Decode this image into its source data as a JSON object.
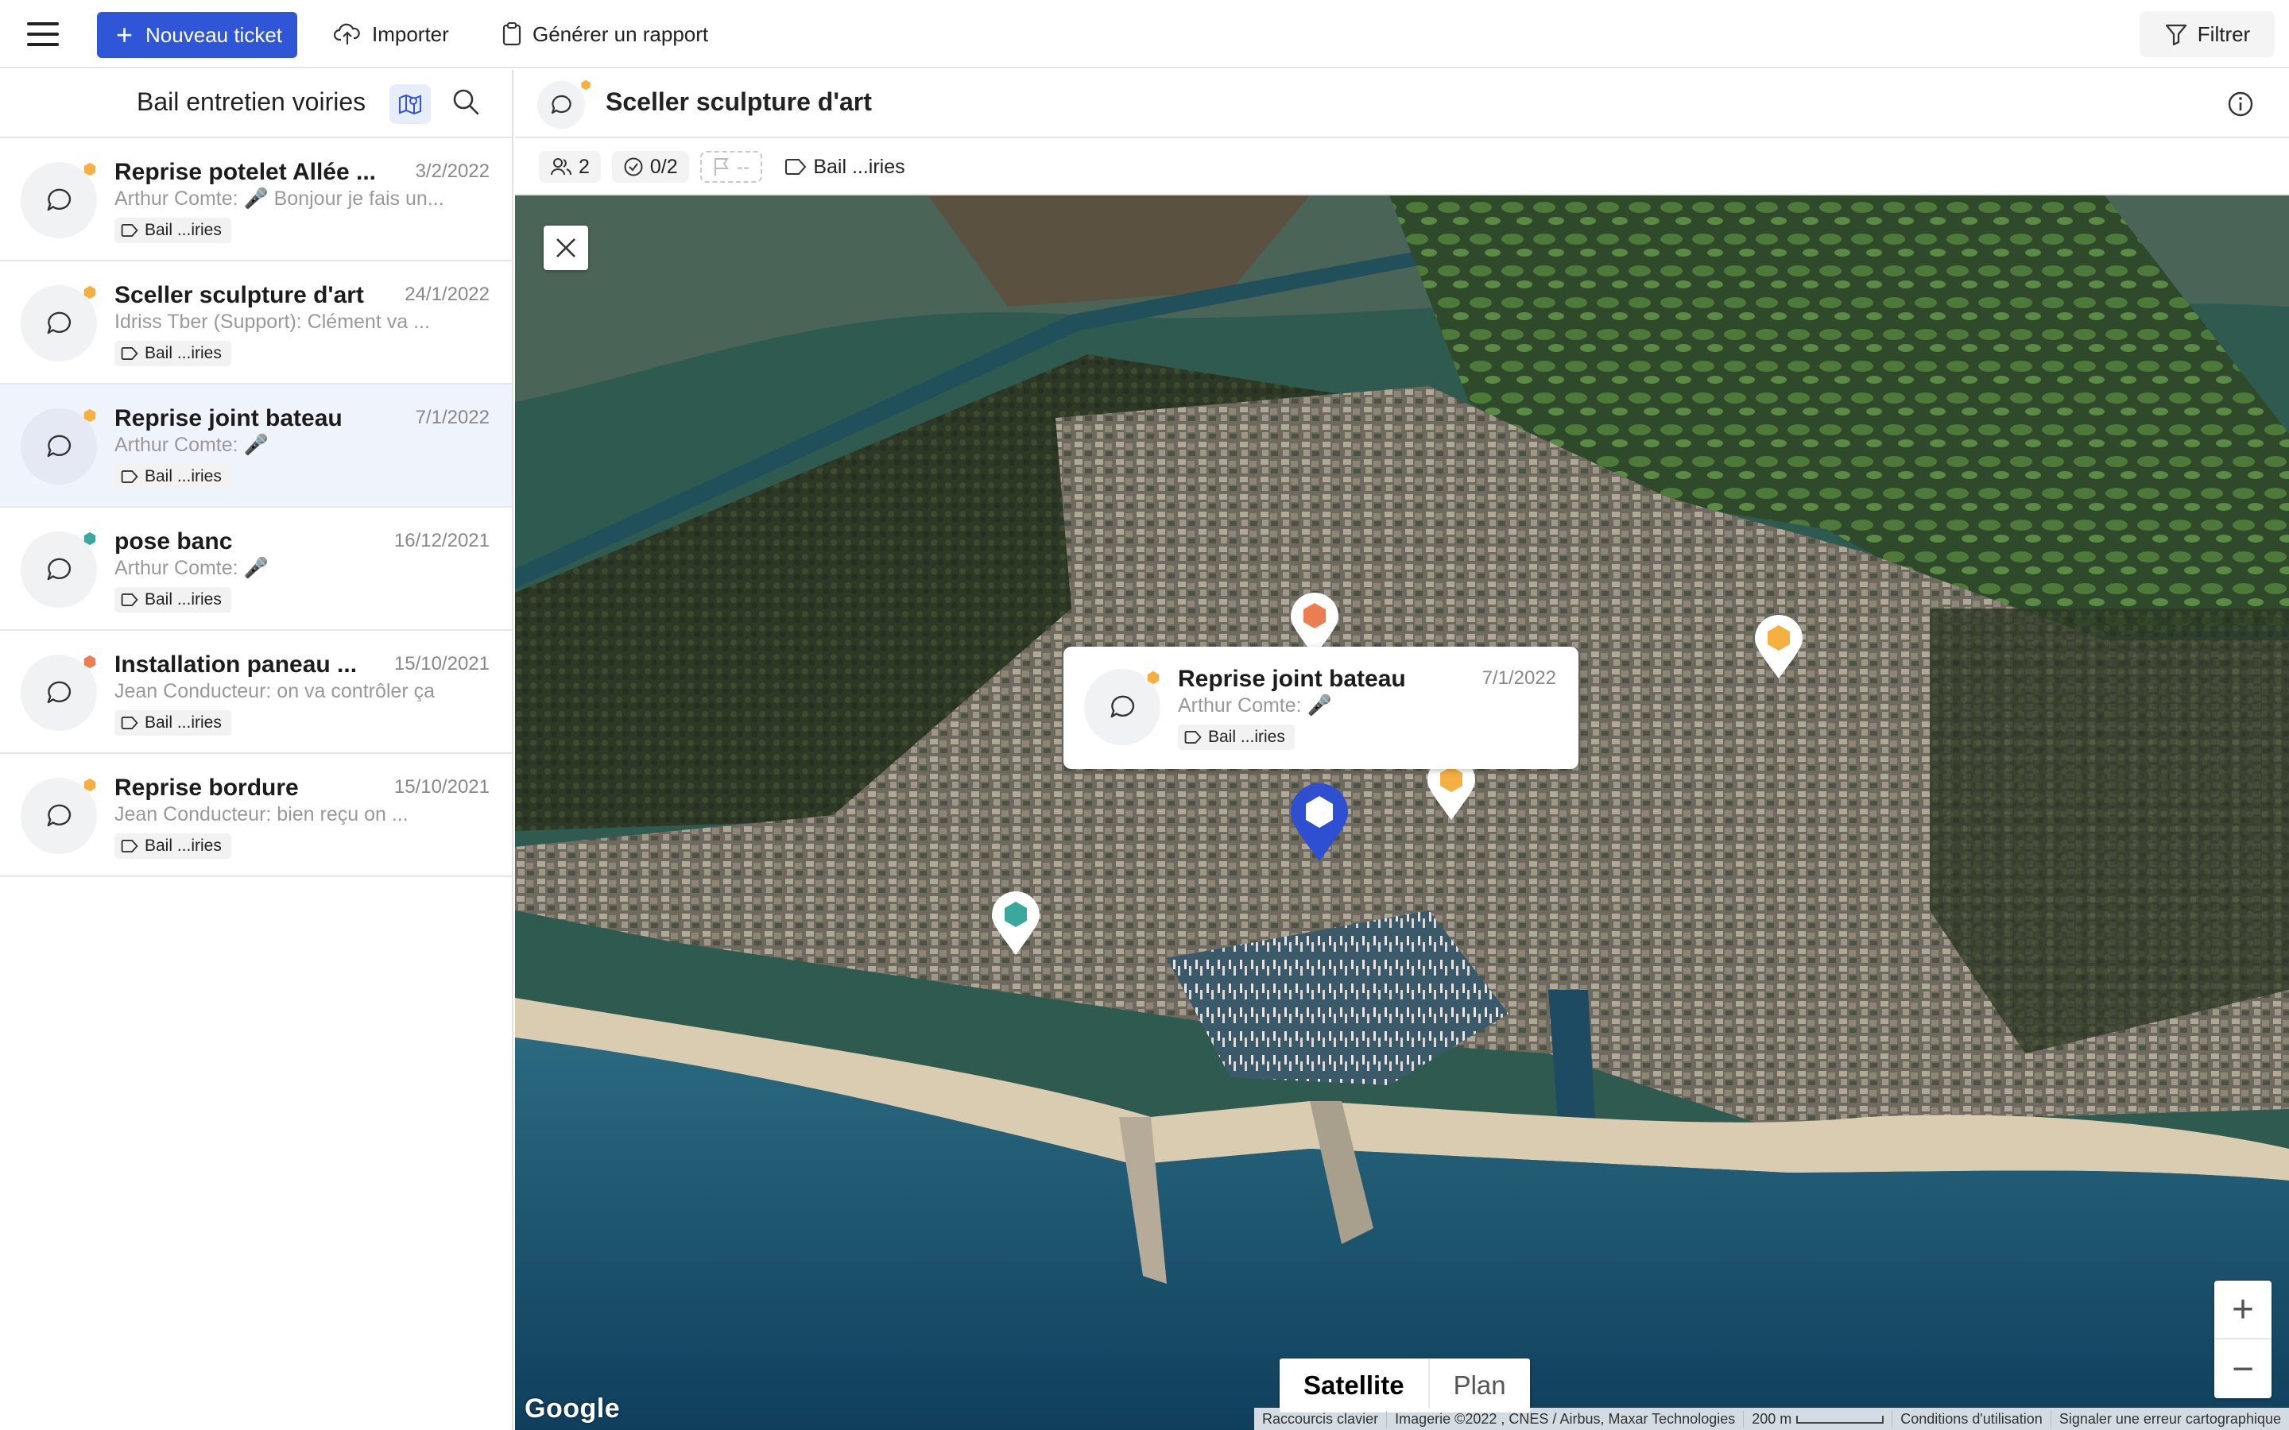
{
  "toolbar": {
    "new_ticket_label": "Nouveau ticket",
    "import_label": "Importer",
    "report_label": "Générer un rapport",
    "filter_label": "Filtrer"
  },
  "sidebar": {
    "title": "Bail entretien voiries",
    "tickets": [
      {
        "title": "Reprise potelet Allée ...",
        "date": "3/2/2022",
        "subtitle": "Arthur Comte: 🎤 Bonjour je fais un...",
        "tag": "Bail ...iries",
        "status_color": "#f5b041"
      },
      {
        "title": "Sceller sculpture d'art",
        "date": "24/1/2022",
        "subtitle": "Idriss Tber (Support): Clément va ...",
        "tag": "Bail ...iries",
        "status_color": "#f5b041"
      },
      {
        "title": "Reprise joint bateau",
        "date": "7/1/2022",
        "subtitle": "Arthur Comte: 🎤",
        "tag": "Bail ...iries",
        "status_color": "#f5b041"
      },
      {
        "title": "pose banc",
        "date": "16/12/2021",
        "subtitle": "Arthur Comte: 🎤",
        "tag": "Bail ...iries",
        "status_color": "#3aa89c"
      },
      {
        "title": "Installation paneau ...",
        "date": "15/10/2021",
        "subtitle": "Jean Conducteur: on va contrôler ça",
        "tag": "Bail ...iries",
        "status_color": "#ec7d52"
      },
      {
        "title": "Reprise bordure",
        "date": "15/10/2021",
        "subtitle": "Jean Conducteur: bien reçu on ...",
        "tag": "Bail ...iries",
        "status_color": "#f5b041"
      }
    ]
  },
  "detail": {
    "title": "Sceller sculpture d'art",
    "participants": "2",
    "tasks": "0/2",
    "priority": "--",
    "tag": "Bail ...iries"
  },
  "map": {
    "popup": {
      "title": "Reprise joint bateau",
      "date": "7/1/2022",
      "subtitle": "Arthur Comte: 🎤",
      "tag": "Bail ...iries"
    },
    "type_satellite": "Satellite",
    "type_plan": "Plan",
    "zoom_in": "+",
    "zoom_out": "−",
    "logo": "Google",
    "attribution": {
      "shortcuts": "Raccourcis clavier",
      "imagery": "Imagerie ©2022 , CNES / Airbus, Maxar Technologies",
      "scale": "200 m",
      "terms": "Conditions d'utilisation",
      "report": "Signaler une erreur cartographique"
    }
  },
  "colors": {
    "accent": "#2f56d6",
    "orange": "#ec7d52",
    "yellow": "#f5b041",
    "teal": "#3aa89c",
    "selected_marker": "#2f4fd1"
  }
}
